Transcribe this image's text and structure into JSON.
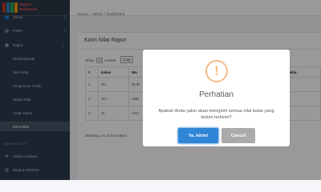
{
  "brand": {
    "line1": "Digital",
    "line2": "Madrasah",
    "logo_colors": [
      "#c0392b",
      "#2e86c1",
      "#27ae60",
      "#f39c12"
    ]
  },
  "sidebar": {
    "items": [
      {
        "label": "Siswa",
        "icon": "users-icon",
        "glyph": "👥"
      },
      {
        "label": "PSRA",
        "icon": "file-icon",
        "glyph": "▤"
      },
      {
        "label": "Rapor",
        "icon": "book-icon",
        "glyph": "▦"
      }
    ],
    "rapor_sub": [
      {
        "label": "Distribusikode"
      },
      {
        "label": "Nilai KKM"
      },
      {
        "label": "Pengaturan Cetak"
      },
      {
        "label": "Status Nilai"
      },
      {
        "label": "Cetak Rapor"
      },
      {
        "label": "Kirim Nilai"
      }
    ],
    "section_header": "ADMINISTRASI",
    "admin_items": [
      {
        "label": "Admin Aplikasi",
        "icon": "user-cog-icon",
        "glyph": "⚙"
      },
      {
        "label": "Backup Restore",
        "icon": "database-icon",
        "glyph": "▥"
      }
    ]
  },
  "breadcrumb": {
    "home": "Home",
    "admin": "Admin",
    "current": "Dashboard",
    "separator": "/"
  },
  "page": {
    "title": "Kirim Nilai Rapor"
  },
  "table_controls": {
    "show_label": "Show",
    "show_value": "10",
    "entries_label": "entries",
    "copy_label": "Copy"
  },
  "table": {
    "headers": [
      "#",
      "Kelas",
      "Wa",
      "",
      "entase Nilai"
    ],
    "rows": [
      [
        "1",
        "VII.",
        "NUR",
        "",
        ""
      ],
      [
        "2",
        "VIII.",
        "ABD",
        "",
        ""
      ],
      [
        "3",
        "IX.",
        "ANA",
        "",
        ""
      ]
    ],
    "info": "Showing 1 to 3 of 3 entries"
  },
  "modal": {
    "icon": "exclamation-icon",
    "icon_glyph": "!",
    "title": "Perhatian",
    "text": "Apakah Anda yakin akan mengirim semua nilai kelas yang belum terkirim?",
    "confirm_label": "Ya, kirim!",
    "cancel_label": "Cancel",
    "colors": {
      "confirm": "#3085d6",
      "cancel": "#aaaaaa",
      "warning": "#f8bb86"
    }
  }
}
